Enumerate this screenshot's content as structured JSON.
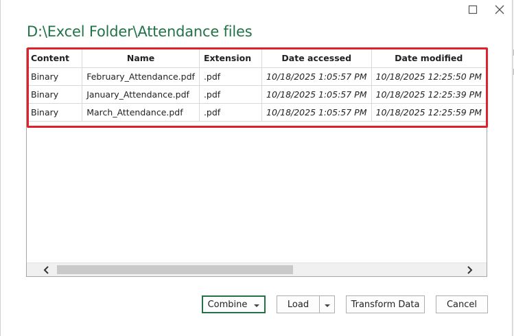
{
  "window": {
    "title": "D:\\Excel Folder\\Attendance files",
    "maximize_glyph": "☐",
    "close_glyph": "✕"
  },
  "table": {
    "columns": [
      "Content",
      "Name",
      "Extension",
      "Date accessed",
      "Date modified"
    ],
    "rows": [
      [
        "Binary",
        "February_Attendance.pdf",
        ".pdf",
        "10/18/2025 1:05:57 PM",
        "10/18/2025 12:25:50 PM"
      ],
      [
        "Binary",
        "January_Attendance.pdf",
        ".pdf",
        "10/18/2025 1:05:57 PM",
        "10/18/2025 12:25:39 PM"
      ],
      [
        "Binary",
        "March_Attendance.pdf",
        ".pdf",
        "10/18/2025 1:05:57 PM",
        "10/18/2025 12:25:59 PM"
      ]
    ]
  },
  "buttons": {
    "combine": "Combine",
    "load": "Load",
    "transform": "Transform Data",
    "cancel": "Cancel"
  },
  "colors": {
    "title": "#217346",
    "highlight": "#e0202a"
  },
  "icons": {
    "maximize": "maximize-icon",
    "close": "close-icon",
    "scroll_left": "chevron-left-icon",
    "scroll_right": "chevron-right-icon",
    "dropdown": "caret-down-icon"
  }
}
